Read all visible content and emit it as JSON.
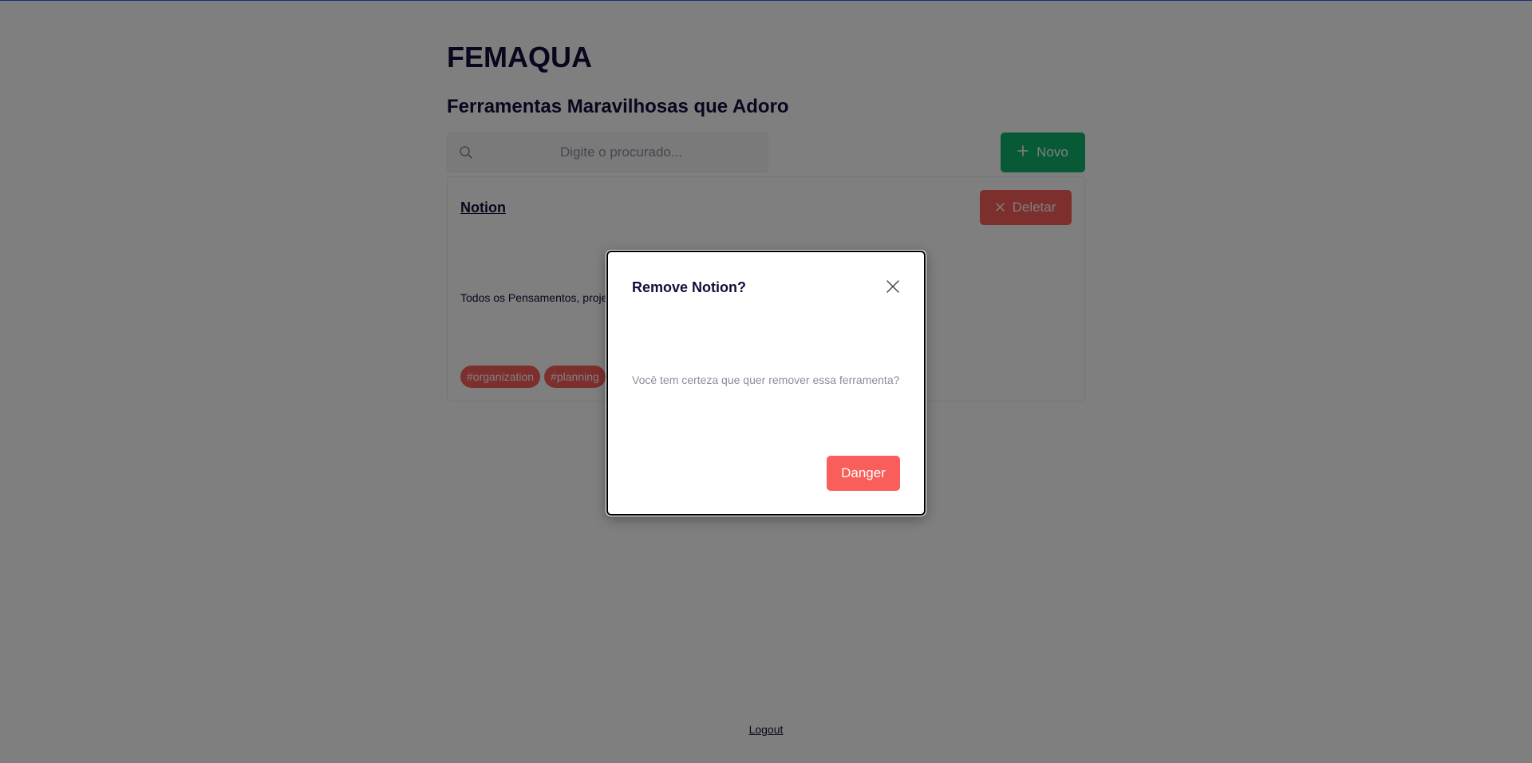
{
  "app": {
    "title": "FEMAQUA",
    "subtitle": "Ferramentas Maravilhosas que Adoro"
  },
  "toolbar": {
    "search_placeholder": "Digite o procurado...",
    "new_button_label": "Novo"
  },
  "tools": [
    {
      "name": "Notion",
      "delete_label": "Deletar",
      "description": "Todos os Pensamentos, projet",
      "tags": [
        "#organization",
        "#planning"
      ]
    }
  ],
  "footer": {
    "logout_label": "Logout"
  },
  "modal": {
    "title": "Remove Notion?",
    "message": "Você tem certeza que quer remover essa ferramenta?",
    "confirm_label": "Danger"
  },
  "colors": {
    "primary": "#365df0",
    "success": "#10b26c",
    "danger": "#f95e5a",
    "text": "#170c3a",
    "muted": "#8f8a9b"
  },
  "icons": {
    "search": "search-icon",
    "add": "plus-icon",
    "delete": "close-icon",
    "close_modal": "close-icon"
  }
}
